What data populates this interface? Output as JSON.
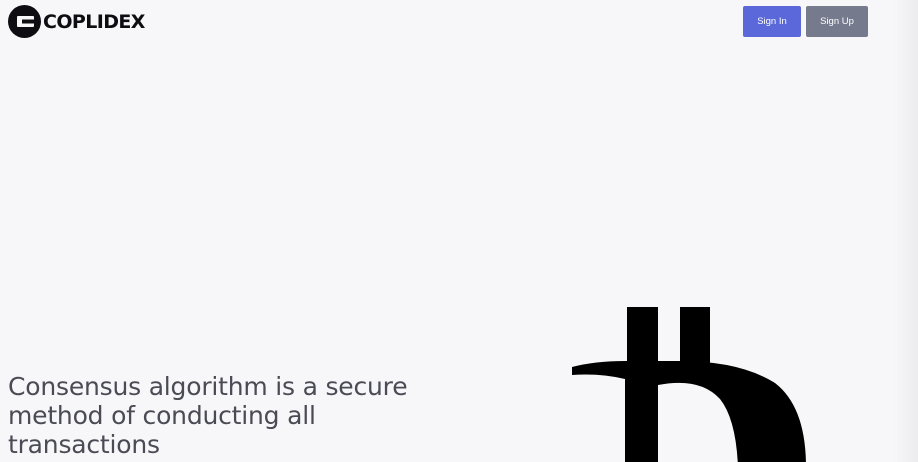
{
  "header": {
    "logo_text": "COPLIDEX",
    "logo_icon": "coplidex-logo-icon",
    "sign_in_label": "Sign In",
    "sign_up_label": "Sign Up"
  },
  "hero": {
    "heading": "Consensus algorithm is a secure method of conducting all transactions",
    "graphic_icon": "bitcoin-icon"
  },
  "colors": {
    "background": "#f7f7f9",
    "sign_in_button": "#5a68da",
    "sign_up_button": "#767a8d",
    "heading_text": "#4b4b55",
    "logo": "#0d0d12"
  }
}
